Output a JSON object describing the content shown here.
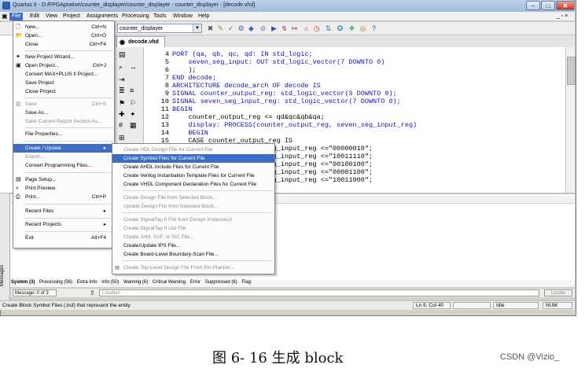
{
  "window": {
    "title": "Quartus II - D:/FPGApratise/counter_displayer/counter_displayer - counter_displayer - [decode.vhd]"
  },
  "menubar": [
    "File",
    "Edit",
    "View",
    "Project",
    "Assignments",
    "Processing",
    "Tools",
    "Window",
    "Help"
  ],
  "toolbar": {
    "project_combo": "counter_displayer"
  },
  "editor": {
    "tab_label": "decode.vhd",
    "lines": [
      {
        "n": "4",
        "text": "PORT (qa, qb, qc, qd: IN std_logic;"
      },
      {
        "n": "5",
        "text": "    seven_seg_input: OUT std_logic_vector(7 DOWNTO 0)"
      },
      {
        "n": "6",
        "text": "    );"
      },
      {
        "n": "7",
        "text": "END decode;"
      },
      {
        "n": "8",
        "text": "ARCHITECTURE decode_arch OF decode IS"
      },
      {
        "n": "9",
        "text": "SIGNAL counter_output_reg: std_logic_vector(3 DOWNTO 0);"
      },
      {
        "n": "10",
        "text": "SIGNAL seven_seg_input_reg: std_logic_vector(7 DOWNTO 0);"
      },
      {
        "n": "11",
        "text": "BEGIN"
      },
      {
        "n": "12",
        "text": "    counter_output_reg <= qd&qc&qb&qa;"
      },
      {
        "n": "13",
        "text": "    display: PROCESS(counter_output_reg, seven_seg_input_reg)"
      },
      {
        "n": "14",
        "text": "    BEGIN"
      },
      {
        "n": "15",
        "text": "    CASE counter_output_reg IS"
      },
      {
        "n": "",
        "text": "                  even_seg_input_reg <=\"00000010\";"
      },
      {
        "n": "",
        "text": "                  even_seg_input_reg <=\"10011110\";"
      },
      {
        "n": "",
        "text": "                  even_seg_input_reg <=\"00100100\";"
      },
      {
        "n": "",
        "text": "                  even_seg_input_reg <=\"00001100\";"
      },
      {
        "n": "",
        "text": "                  even_seg_input_reg <=\"10011000\";"
      }
    ]
  },
  "file_menu": [
    {
      "label": "New...",
      "shortcut": "Ctrl+N",
      "icon": "new-file-icon"
    },
    {
      "label": "Open...",
      "shortcut": "Ctrl+O",
      "icon": "open-folder-icon"
    },
    {
      "label": "Close",
      "shortcut": "Ctrl+F4"
    },
    {
      "sep": true
    },
    {
      "label": "New Project Wizard...",
      "icon": "wizard-icon"
    },
    {
      "label": "Open Project...",
      "shortcut": "Ctrl+J",
      "icon": "open-project-icon"
    },
    {
      "label": "Convert MAX+PLUS II Project..."
    },
    {
      "label": "Save Project"
    },
    {
      "label": "Close Project"
    },
    {
      "sep": true
    },
    {
      "label": "Save",
      "shortcut": "Ctrl+S",
      "disabled": true,
      "icon": "save-icon"
    },
    {
      "label": "Save As..."
    },
    {
      "label": "Save Current Report Section As...",
      "disabled": true
    },
    {
      "sep": true
    },
    {
      "label": "File Properties..."
    },
    {
      "sep": true
    },
    {
      "label": "Create / Update",
      "submenu": true,
      "highlighted": true
    },
    {
      "label": "Export...",
      "disabled": true
    },
    {
      "label": "Convert Programming Files..."
    },
    {
      "sep": true
    },
    {
      "label": "Page Setup...",
      "icon": "page-setup-icon"
    },
    {
      "label": "Print Preview",
      "icon": "print-preview-icon"
    },
    {
      "label": "Print...",
      "shortcut": "Ctrl+P",
      "icon": "print-icon"
    },
    {
      "sep": true
    },
    {
      "label": "Recent Files",
      "submenu": true
    },
    {
      "sep": true
    },
    {
      "label": "Recent Projects",
      "submenu": true
    },
    {
      "sep": true
    },
    {
      "label": "Exit",
      "shortcut": "Alt+F4"
    }
  ],
  "submenu": [
    {
      "label": "Create HDL Design File for Current File",
      "disabled": true
    },
    {
      "label": "Create Symbol Files for Current File",
      "highlighted": true
    },
    {
      "label": "Create AHDL Include Files for Current File"
    },
    {
      "label": "Create Verilog Instantiation Template Files for Current File"
    },
    {
      "label": "Create VHDL Component Declaration Files for Current File"
    },
    {
      "sep": true
    },
    {
      "label": "Create Design File from Selected Block...",
      "disabled": true
    },
    {
      "label": "Update Design File from Selected Block...",
      "disabled": true
    },
    {
      "sep": true
    },
    {
      "label": "Create SignalTap II File from Design Instance(s)",
      "disabled": true
    },
    {
      "label": "Create SignalTap II List File",
      "disabled": true
    },
    {
      "label": "Create JAM, SVF, or ISC File...",
      "disabled": true
    },
    {
      "label": "Create/Update IPS File..."
    },
    {
      "label": "Create Board-Level Boundary-Scan File..."
    },
    {
      "sep": true
    },
    {
      "label": "Create Top-Level Design File From Pin Planner...",
      "disabled": true
    }
  ],
  "messages": {
    "panel_label": "Messages",
    "tabs": [
      "System (3)",
      "Processing (56)",
      "Extra Info",
      "Info (50)",
      "Warning (6)",
      "Critical Warning",
      "Error",
      "Suppressed (6)",
      "Flag"
    ],
    "message_count": "Message: 0 of 3",
    "location_placeholder": "Location",
    "locate_button": "Locate"
  },
  "status": {
    "hint": "Create Block Symbol Files (.bsf) that represent the entity",
    "position": "Ln 9, Col 40",
    "state": "Idle",
    "num": "NUM"
  },
  "caption": "图 6- 16 生成 block",
  "watermark": "CSDN @Vizio_"
}
